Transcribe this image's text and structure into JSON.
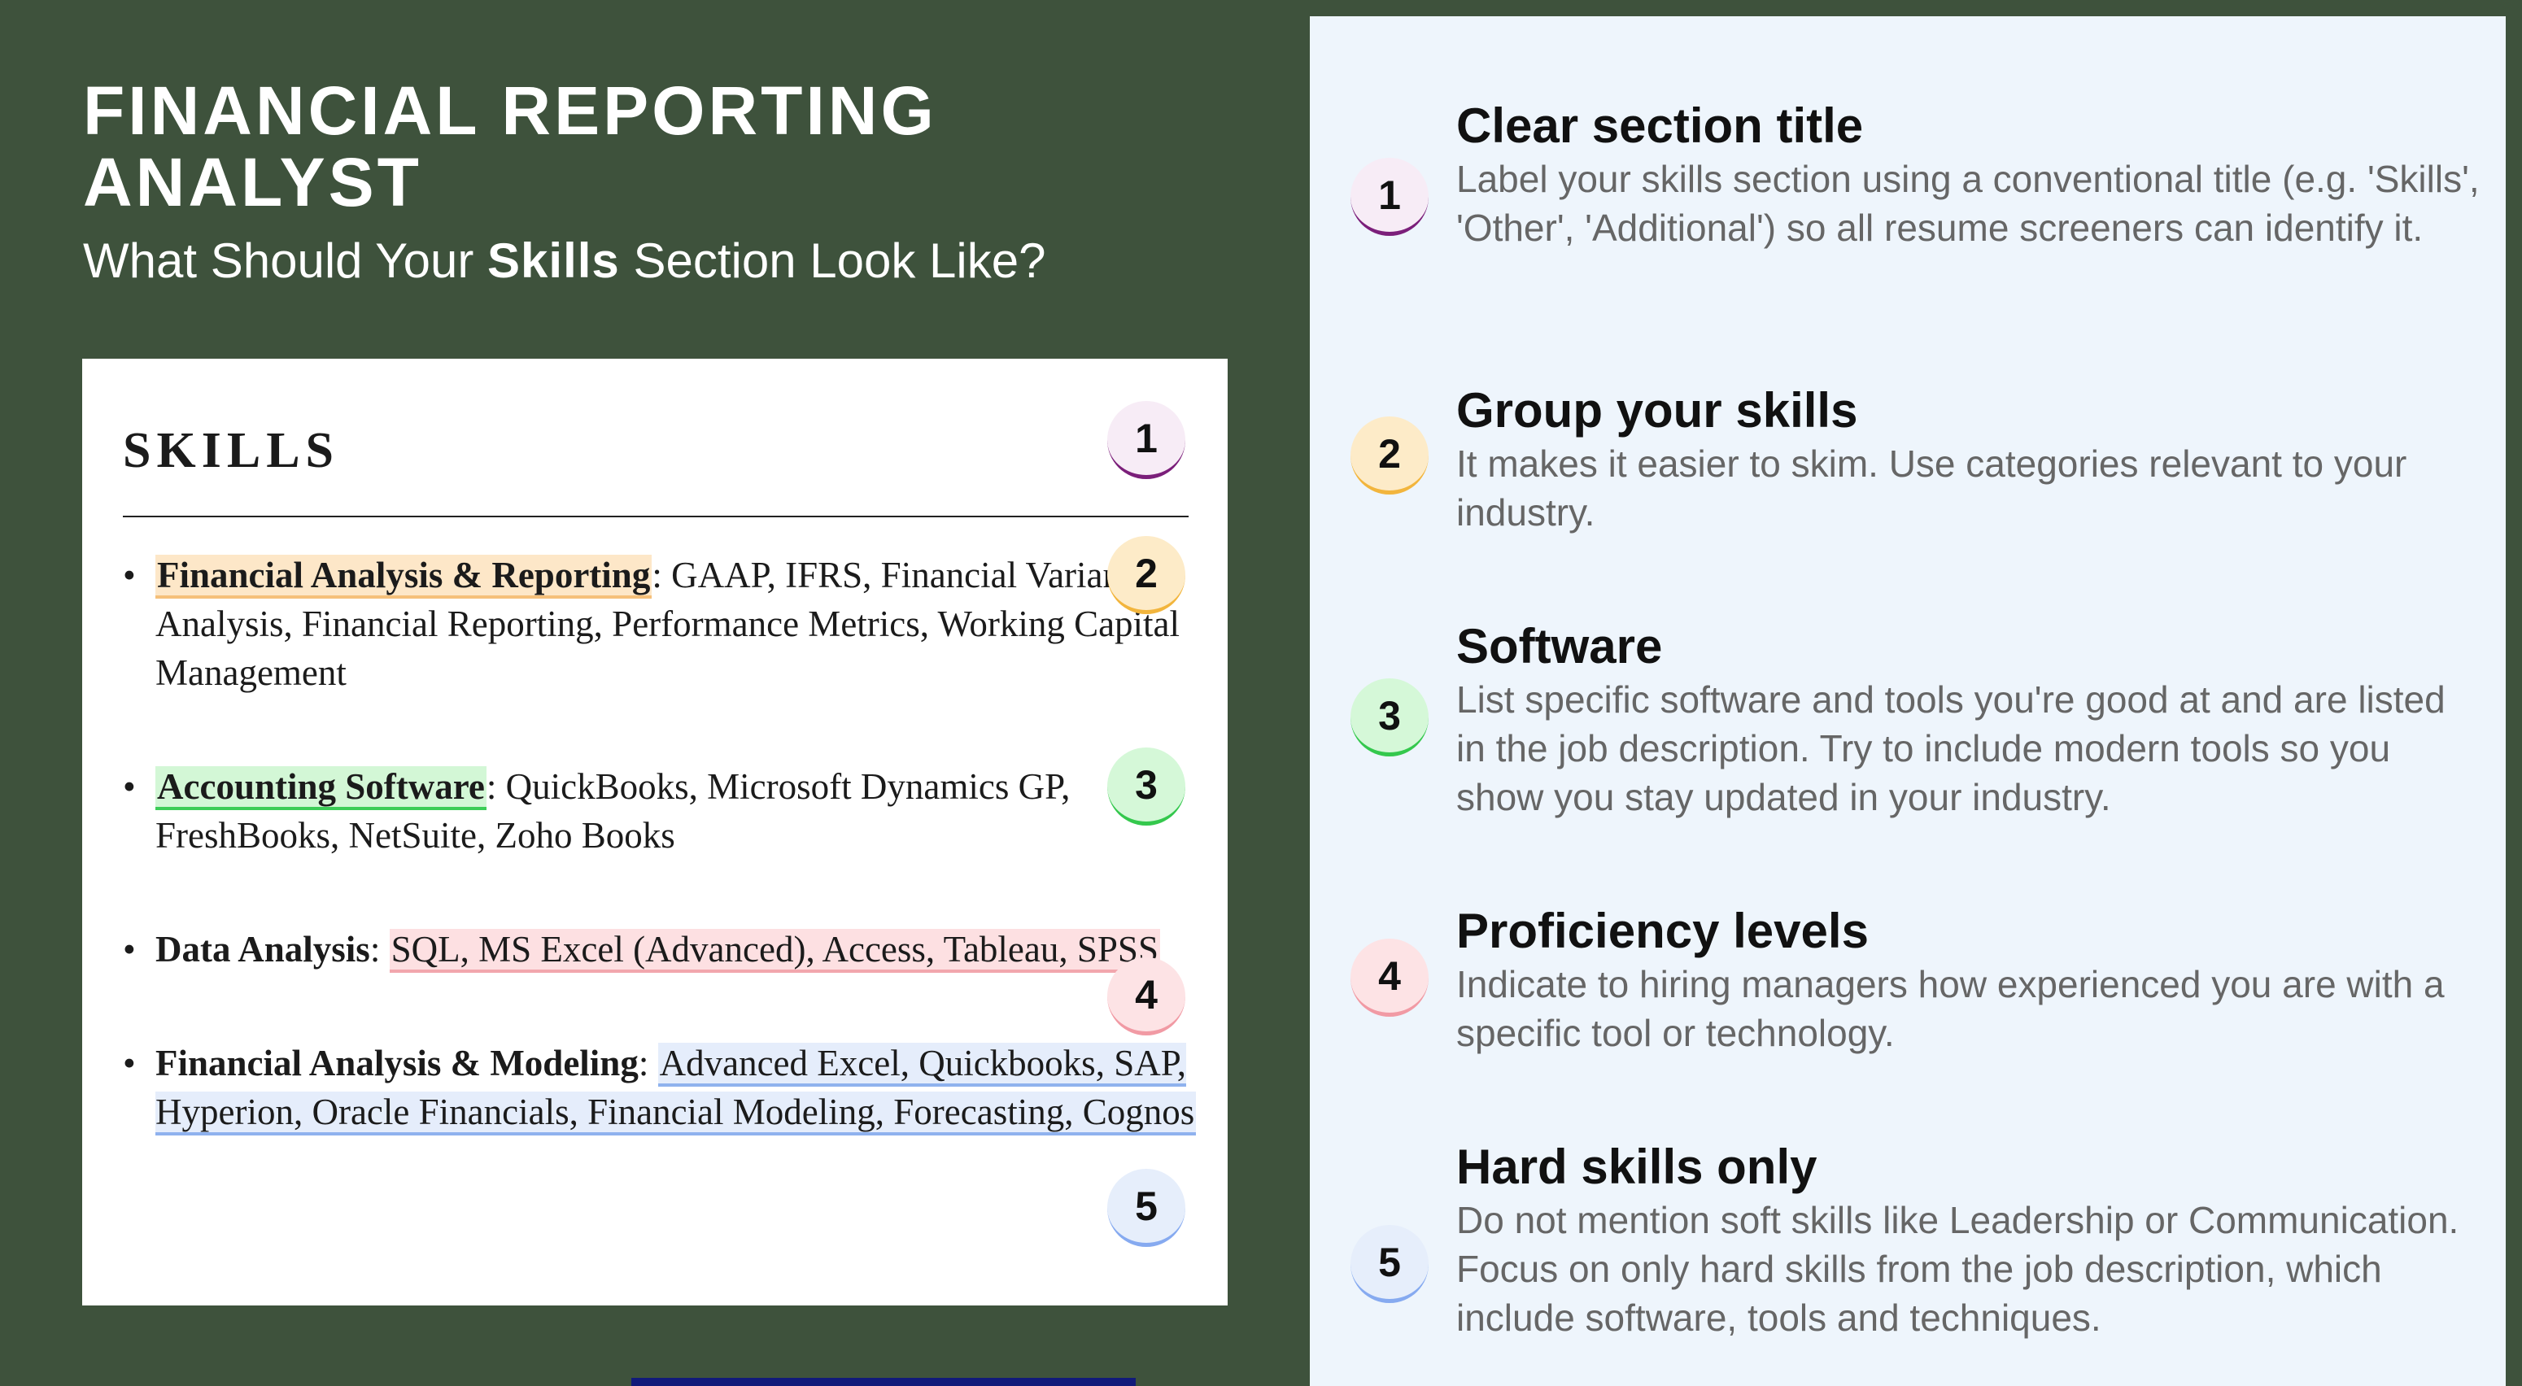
{
  "header": {
    "title": "FINANCIAL REPORTING ANALYST",
    "subtitle_before": "What Should Your ",
    "subtitle_bold": "Skills",
    "subtitle_after": " Section Look Like?"
  },
  "resume_card": {
    "heading": "SKILLS",
    "skills": [
      {
        "category": "Financial Analysis & Reporting",
        "items": ": GAAP, IFRS, Financial Variance Analysis, Financial Reporting, Performance Metrics, Working Capital Management"
      },
      {
        "category": "Accounting Software",
        "items": ": QuickBooks, Microsoft Dynamics GP, FreshBooks, NetSuite, Zoho Books"
      },
      {
        "category": "Data Analysis",
        "separator": ": ",
        "items": "SQL, MS Excel (Advanced), Access, Tableau, SPSS"
      },
      {
        "category": "Financial Analysis & Modeling",
        "separator": ": ",
        "items": "Advanced Excel, Quickbooks, SAP, Hyperion, Oracle Financials, Financial Modeling, Forecasting, Cognos"
      }
    ],
    "badges": [
      "1",
      "2",
      "3",
      "4",
      "5"
    ]
  },
  "tips": [
    {
      "number": "1",
      "title": "Clear section title",
      "description": "Label your skills section using a conventional title (e.g. 'Skills', 'Other', 'Additional') so all resume screeners can identify it."
    },
    {
      "number": "2",
      "title": "Group your skills",
      "description": "It makes it easier to skim. Use categories relevant to your industry."
    },
    {
      "number": "3",
      "title": "Software",
      "description": "List specific software and tools you're good at and are listed in the job description. Try to include modern tools so you show you stay updated in your industry."
    },
    {
      "number": "4",
      "title": "Proficiency levels",
      "description": "Indicate to hiring managers how experienced you are with a specific tool or technology."
    },
    {
      "number": "5",
      "title": "Hard skills only",
      "description": "Do not mention soft skills like Leadership or Communication. Focus on only hard skills from the job description, which include software, tools and techniques."
    }
  ],
  "colors": {
    "background": "#3e523c",
    "panel": "#eef5fc",
    "badge_1": "#7b1f7a",
    "badge_2": "#f2b53d",
    "badge_3": "#34c84d",
    "badge_4": "#f19aa4",
    "badge_5": "#86aaf0"
  }
}
